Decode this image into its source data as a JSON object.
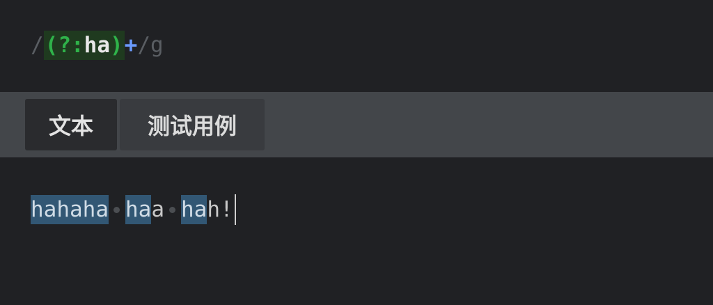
{
  "expression": {
    "open_delim": "/",
    "group": "(?:",
    "literal": "ha",
    "group_close": ")",
    "quantifier": "+",
    "close_delim": "/",
    "flags": "g"
  },
  "tabs": [
    {
      "label": "文本",
      "active": true
    },
    {
      "label": "测试用例",
      "active": false
    }
  ],
  "text": {
    "segments": [
      {
        "text": "hahaha",
        "match": true
      },
      {
        "text": " ",
        "space": true
      },
      {
        "text": "ha",
        "match": true
      },
      {
        "text": "a",
        "match": false
      },
      {
        "text": " ",
        "space": true
      },
      {
        "text": "ha",
        "match": true
      },
      {
        "text": "h!",
        "match": false
      }
    ]
  },
  "colors": {
    "match_highlight": "#325774",
    "group_highlight": "#1f3a1f",
    "group_token": "#2fb24a",
    "quantifier_token": "#6b9cff"
  }
}
